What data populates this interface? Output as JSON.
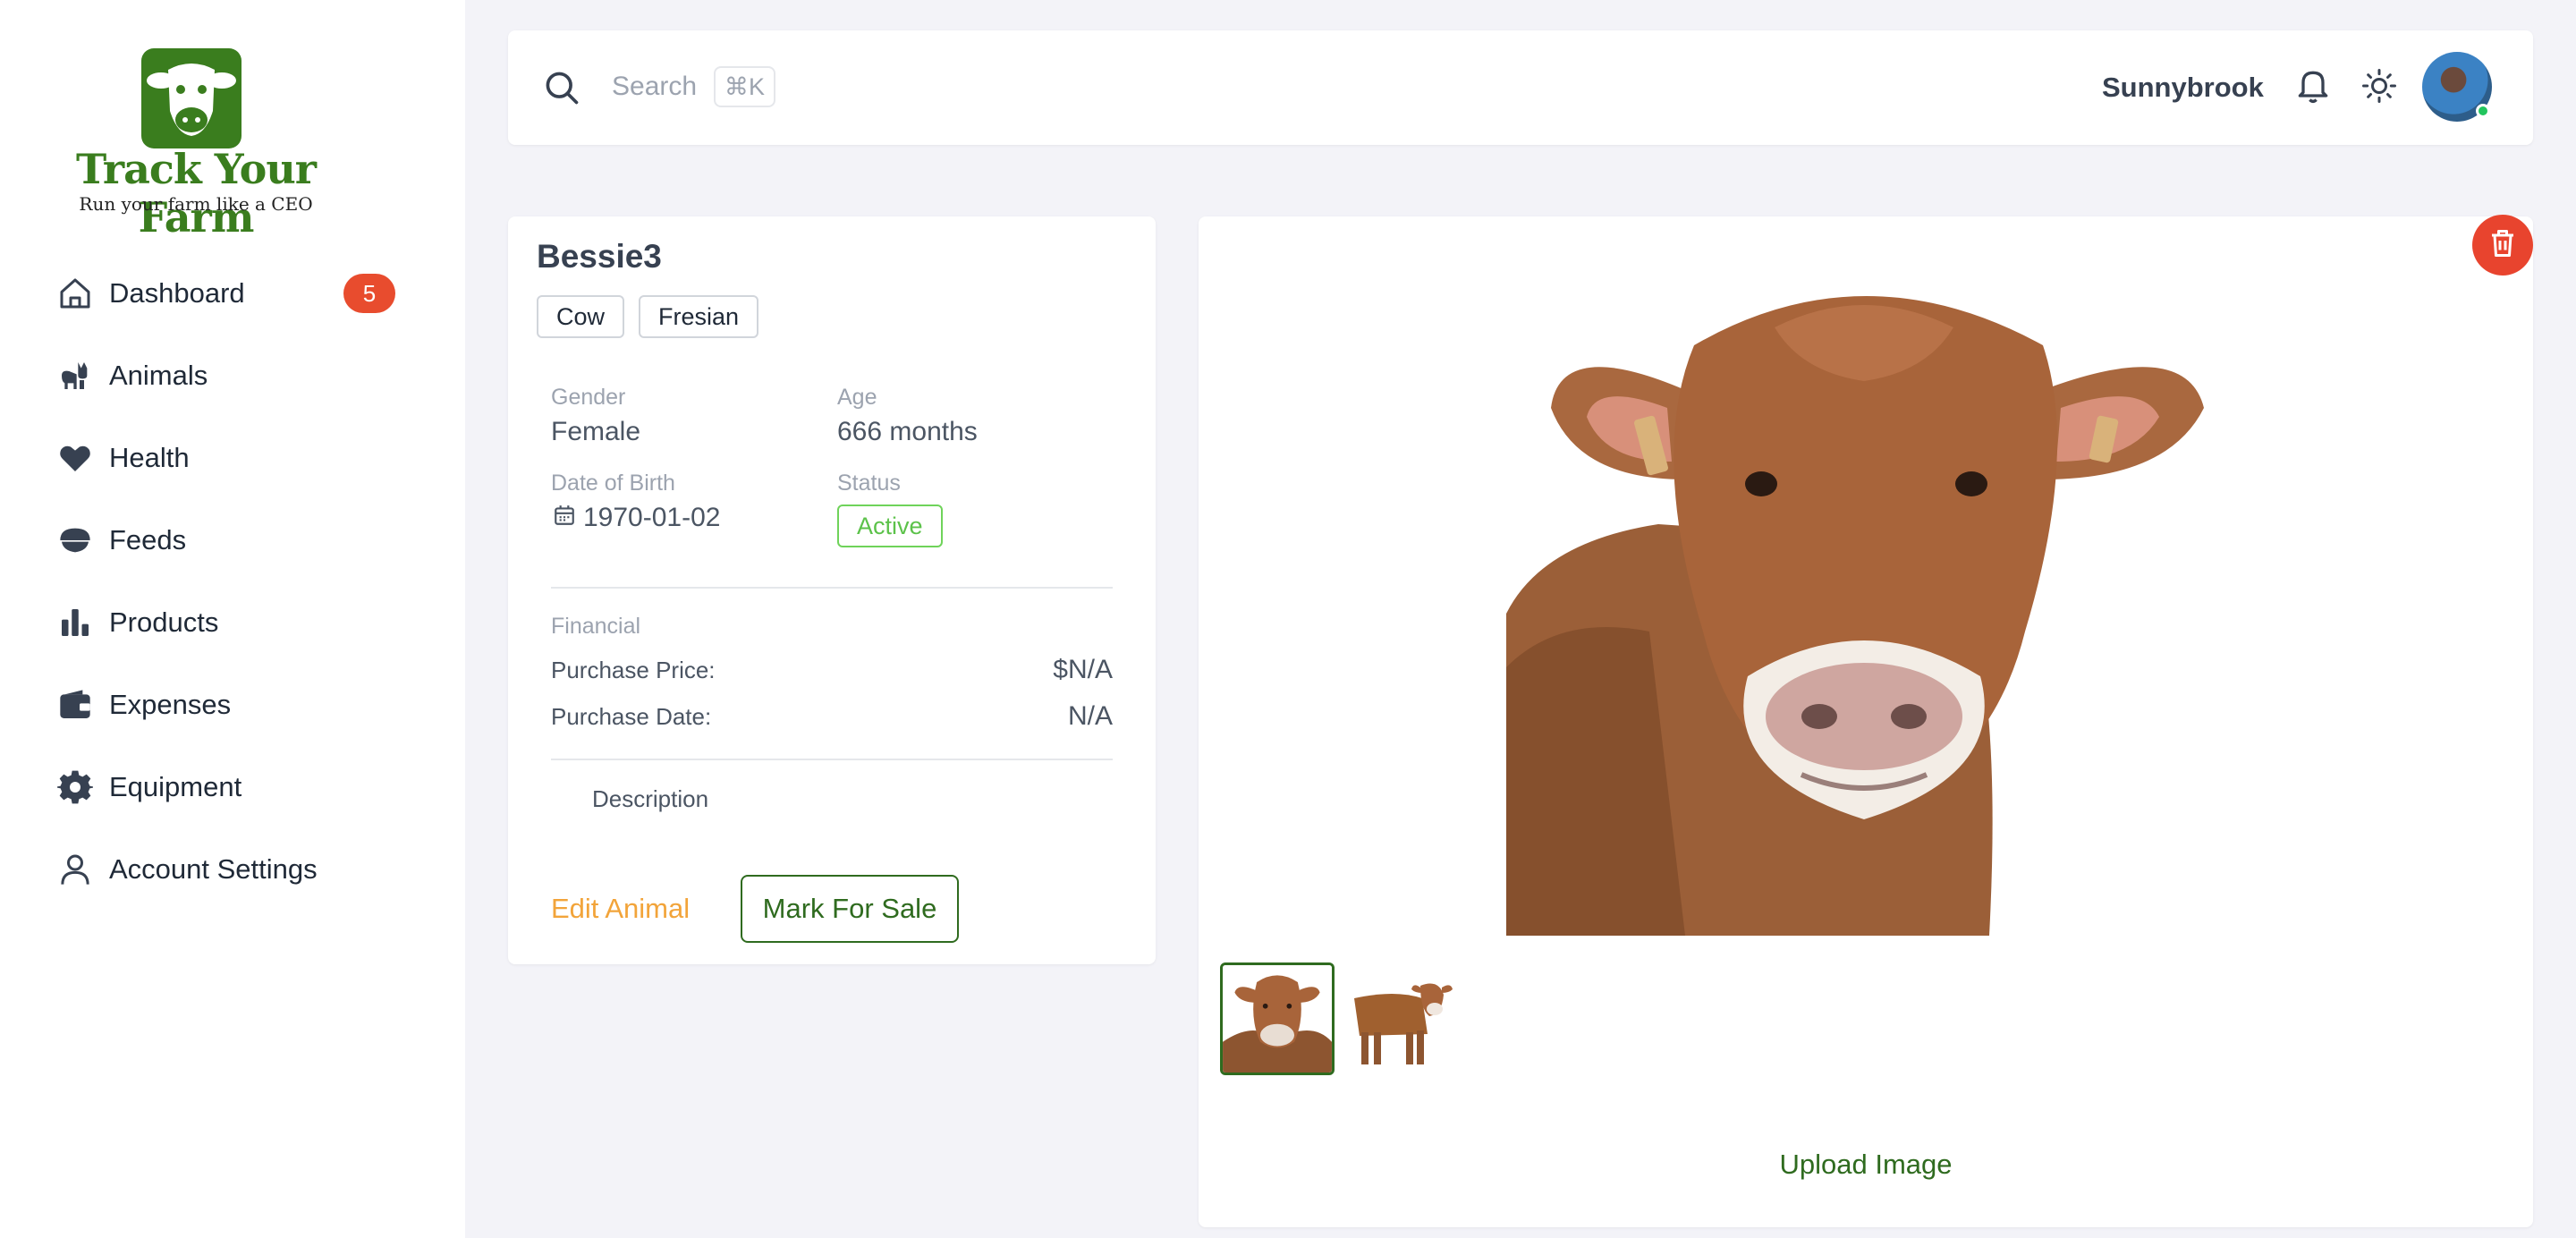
{
  "brand": {
    "title": "Track Your Farm",
    "subtitle": "Run your farm like a CEO",
    "color": "#3a7d1e"
  },
  "sidebar": {
    "items": [
      {
        "label": "Dashboard",
        "icon": "home-icon",
        "badge": "5"
      },
      {
        "label": "Animals",
        "icon": "cat-icon"
      },
      {
        "label": "Health",
        "icon": "heart-icon"
      },
      {
        "label": "Feeds",
        "icon": "feed-bowl-icon"
      },
      {
        "label": "Products",
        "icon": "bar-chart-icon"
      },
      {
        "label": "Expenses",
        "icon": "wallet-icon"
      },
      {
        "label": "Equipment",
        "icon": "gear-icon"
      },
      {
        "label": "Account Settings",
        "icon": "user-icon"
      }
    ]
  },
  "topbar": {
    "search_placeholder": "Search",
    "shortcut": "⌘K",
    "farm_name": "Sunnybrook"
  },
  "animal": {
    "name": "Bessie3",
    "tags": [
      "Cow",
      "Fresian"
    ],
    "gender_label": "Gender",
    "gender": "Female",
    "age_label": "Age",
    "age": "666 months",
    "dob_label": "Date of Birth",
    "dob": "1970-01-02",
    "status_label": "Status",
    "status": "Active",
    "financial_label": "Financial",
    "purchase_price_label": "Purchase Price:",
    "purchase_price": "$N/A",
    "purchase_date_label": "Purchase Date:",
    "purchase_date": "N/A",
    "description_label": "Description"
  },
  "actions": {
    "edit": "Edit Animal",
    "sale": "Mark For Sale",
    "upload": "Upload Image"
  },
  "colors": {
    "accent_green": "#2f6b1f",
    "danger": "#e8442e",
    "badge": "#e84c2e",
    "edit_orange": "#f2a43a",
    "active_green": "#5cc24a"
  }
}
